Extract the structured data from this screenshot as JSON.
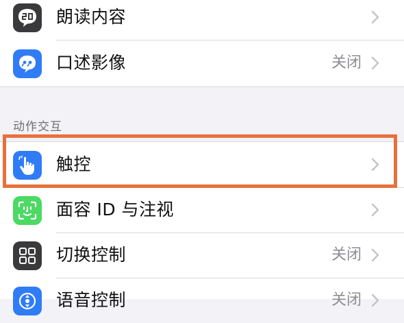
{
  "top_group": {
    "items": [
      {
        "label": "朗读内容",
        "value": ""
      },
      {
        "label": "口述影像",
        "value": "关闭"
      }
    ]
  },
  "section": {
    "header": "动作交互",
    "items": [
      {
        "label": "触控",
        "value": ""
      },
      {
        "label": "面容 ID 与注视",
        "value": ""
      },
      {
        "label": "切换控制",
        "value": "关闭"
      },
      {
        "label": "语音控制",
        "value": "关闭"
      }
    ]
  },
  "colors": {
    "highlight_border": "#e8703c",
    "icon_speak": "#3a3a3c",
    "icon_audio_desc": "#2f7cf6",
    "icon_touch": "#2f7cf6",
    "icon_face_id": "#4cd964",
    "icon_switch": "#3a3a3c",
    "icon_voice": "#2f7cf6"
  }
}
